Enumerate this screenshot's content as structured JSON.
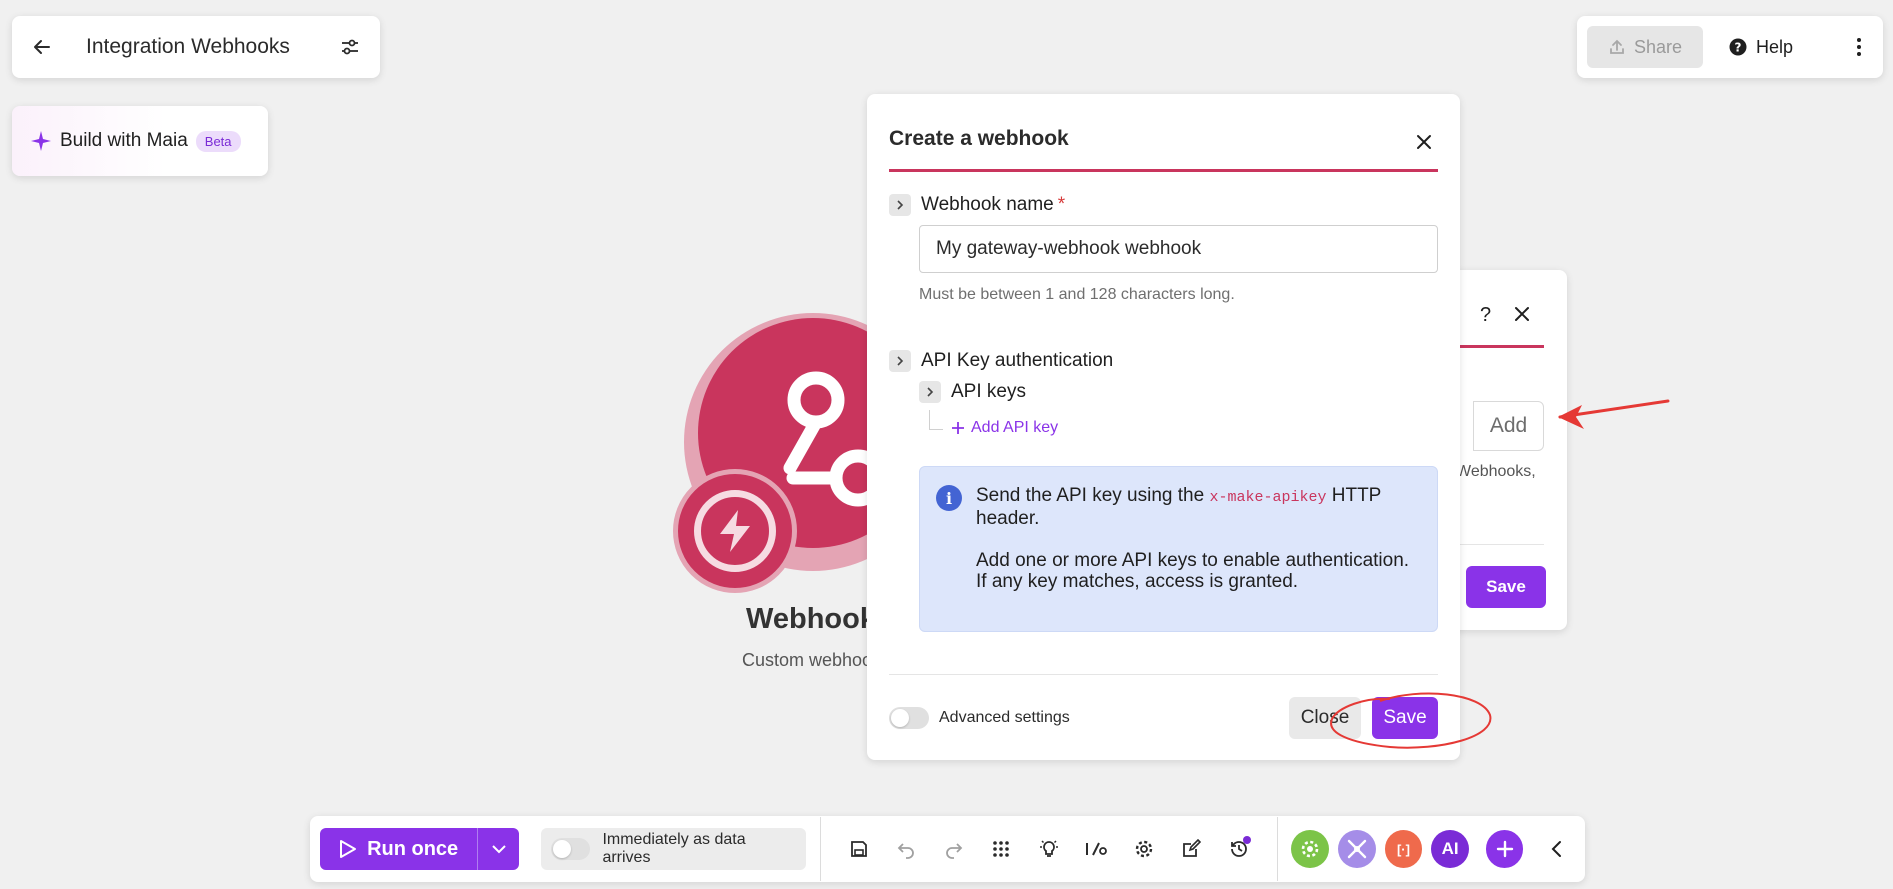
{
  "header": {
    "title": "Integration Webhooks"
  },
  "maia": {
    "label": "Build with Maia",
    "badge": "Beta"
  },
  "top_right": {
    "share": "Share",
    "help": "Help"
  },
  "module": {
    "name": "Webhooks",
    "subtitle": "Custom webhook"
  },
  "back_panel": {
    "help": "?",
    "add": "Add",
    "text": "Webhooks,",
    "save": "Save"
  },
  "dialog": {
    "title": "Create a webhook",
    "name_label": "Webhook name",
    "required_mark": "*",
    "name_value": "My gateway-webhook webhook",
    "name_hint": "Must be between 1 and 128 characters long.",
    "auth_label": "API Key authentication",
    "api_keys_label": "API keys",
    "add_api_key": "Add API key",
    "info": {
      "line1_before": "Send the API key using the ",
      "line1_code": "x-make-apikey",
      "line1_after": " HTTP header.",
      "line2": "Add one or more API keys to enable authentication. If any key matches, access is granted."
    },
    "advanced_settings": "Advanced settings",
    "close": "Close",
    "save": "Save"
  },
  "toolbar": {
    "run_once": "Run once",
    "schedule": "Immediately as data arrives",
    "apps": [
      {
        "name": "app-gear",
        "color": "#7cc448",
        "label": ""
      },
      {
        "name": "app-tools",
        "color": "#a58de8",
        "label": ""
      },
      {
        "name": "app-brackets",
        "color": "#ef6a4c",
        "label": "[·]"
      },
      {
        "name": "app-ai",
        "color": "#7a2bd6",
        "label": "AI"
      }
    ]
  },
  "colors": {
    "accent": "#8a33e8",
    "module": "#c9355d",
    "annotation": "#e53935"
  }
}
